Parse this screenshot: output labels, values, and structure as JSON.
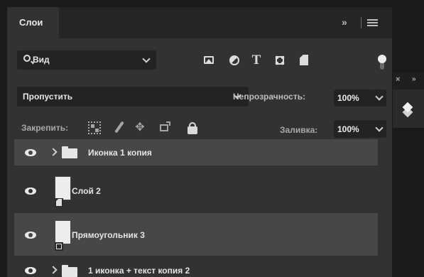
{
  "panel": {
    "tab_label": "Слои",
    "collapse_glyph": "»"
  },
  "filter": {
    "kind_label": "Вид",
    "icons": [
      "image-filter-icon",
      "adjustment-filter-icon",
      "type-filter-icon",
      "shape-filter-icon",
      "smart-object-filter-icon"
    ],
    "type_glyph": "T"
  },
  "blend": {
    "mode": "Пропустить",
    "opacity_label": "Непрозрачность:",
    "opacity_value": "100%"
  },
  "locks": {
    "label": "Закрепить:",
    "icons": [
      "lock-transparent-pixels-icon",
      "lock-image-pixels-icon",
      "lock-position-icon",
      "lock-artboard-icon",
      "lock-all-icon"
    ],
    "move_glyph": "✥",
    "fill_label": "Заливка:",
    "fill_value": "100%"
  },
  "layers": [
    {
      "name": "Иконка 1 копия",
      "kind": "group",
      "selected": true
    },
    {
      "name": "Слой 2",
      "kind": "smart-object",
      "selected": false
    },
    {
      "name": "Прямоугольник 3",
      "kind": "shape",
      "selected": true
    },
    {
      "name": "1 иконка + текст копия 2",
      "kind": "group",
      "selected": false
    }
  ],
  "dock": {
    "close_glyph": "×",
    "expand_glyph": "»",
    "icon": "layers-icon"
  },
  "colors": {
    "panel_bg": "#323232",
    "selected_row": "#474747",
    "field_bg": "#232323"
  }
}
